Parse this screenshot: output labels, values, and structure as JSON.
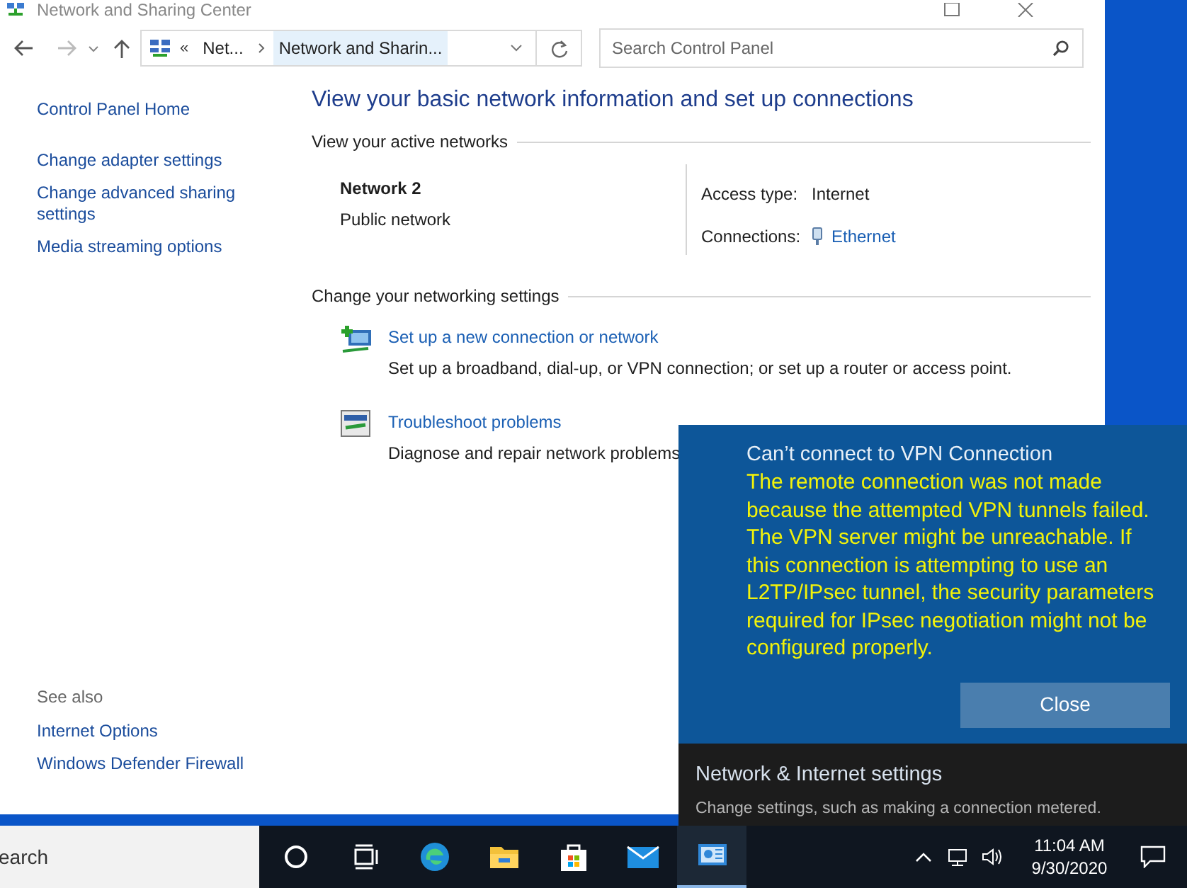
{
  "window": {
    "title": "Network and Sharing Center"
  },
  "address_bar": {
    "breadcrumbs": [
      {
        "label": "Net...",
        "selected": false
      },
      {
        "label": "Network and Sharin...",
        "selected": true
      }
    ],
    "overflow": "«"
  },
  "search": {
    "placeholder": "Search Control Panel"
  },
  "sidebar": {
    "items": [
      {
        "label": "Control Panel Home"
      },
      {
        "label": "Change adapter settings"
      },
      {
        "label": "Change advanced sharing settings"
      },
      {
        "label": "Media streaming options"
      }
    ],
    "see_also": {
      "heading": "See also",
      "items": [
        {
          "label": "Internet Options"
        },
        {
          "label": "Windows Defender Firewall"
        }
      ]
    }
  },
  "main": {
    "heading": "View your basic network information and set up connections",
    "active_networks": {
      "heading": "View your active networks",
      "name": "Network 2",
      "category": "Public network",
      "access_type_label": "Access type:",
      "access_type": "Internet",
      "connections_label": "Connections:",
      "connection": "Ethernet"
    },
    "settings": {
      "heading": "Change your networking settings",
      "items": [
        {
          "kind": "setup",
          "link": "Set up a new connection or network",
          "description": "Set up a broadband, dial-up, or VPN connection; or set up a router or access point."
        },
        {
          "kind": "troubleshoot",
          "link": "Troubleshoot problems",
          "description": "Diagnose and repair network problems"
        }
      ]
    }
  },
  "notification": {
    "title": "Can’t connect to VPN Connection",
    "message": "The remote connection was not made because the attempted VPN tunnels failed. The VPN server might be unreachable. If this connection is attempting to use an L2TP/IPsec tunnel, the security parameters required for IPsec negotiation might not be configured properly.",
    "button": "Close",
    "settings_title": "Network & Internet settings",
    "settings_description": "Change settings, such as making a connection metered."
  },
  "taskbar": {
    "search": "earch",
    "apps": [
      {
        "kind": "cortana",
        "selected": false
      },
      {
        "kind": "taskview",
        "selected": false
      },
      {
        "kind": "edge",
        "selected": false
      },
      {
        "kind": "explorer",
        "selected": false
      },
      {
        "kind": "store",
        "selected": false
      },
      {
        "kind": "mail",
        "selected": false
      },
      {
        "kind": "controlpanel",
        "selected": true
      }
    ],
    "time": "11:04 AM",
    "date": "9/30/2020"
  }
}
